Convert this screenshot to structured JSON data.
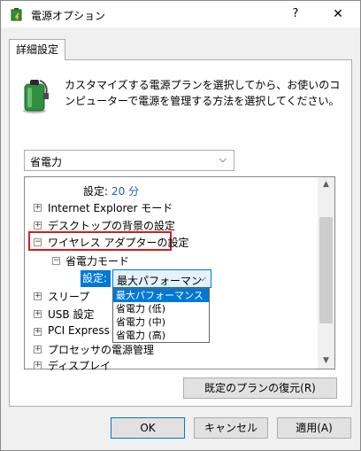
{
  "window": {
    "title": "電源オプション",
    "help_label": "?",
    "close_label": "✕"
  },
  "tab": {
    "label": "詳細設定"
  },
  "description": "カスタマイズする電源プランを選択してから、お使いのコンピューターで電源を管理する方法を選択してください。",
  "plan_select": {
    "value": "省電力"
  },
  "tree": {
    "top_setting_label": "設定:",
    "top_setting_value": "20 分",
    "items": [
      {
        "label": "Internet Explorer モード",
        "expander": "+"
      },
      {
        "label": "デスクトップの背景の設定",
        "expander": "+"
      },
      {
        "label": "ワイヤレス アダプターの設定",
        "expander": "−"
      },
      {
        "label": "省電力モード",
        "expander": "−"
      },
      {
        "label": "スリープ",
        "expander": "+"
      },
      {
        "label": "USB 設定",
        "expander": "+"
      },
      {
        "label": "PCI Express",
        "expander": "+"
      },
      {
        "label": "プロセッサの電源管理",
        "expander": "+"
      },
      {
        "label": "ディスプレイ",
        "expander": "+"
      }
    ],
    "setting_label": "設定:",
    "setting_value": "最大パフォーマンス"
  },
  "dropdown": {
    "options": [
      "最大パフォーマンス",
      "省電力 (低)",
      "省電力 (中)",
      "省電力 (高)"
    ],
    "selected_index": 0
  },
  "buttons": {
    "restore": "既定のプランの復元(R)",
    "ok": "OK",
    "cancel": "キャンセル",
    "apply": "適用(A)"
  },
  "colors": {
    "accent": "#0078d7",
    "highlight_border": "#d02020",
    "top_value": "#1a5fb4"
  }
}
